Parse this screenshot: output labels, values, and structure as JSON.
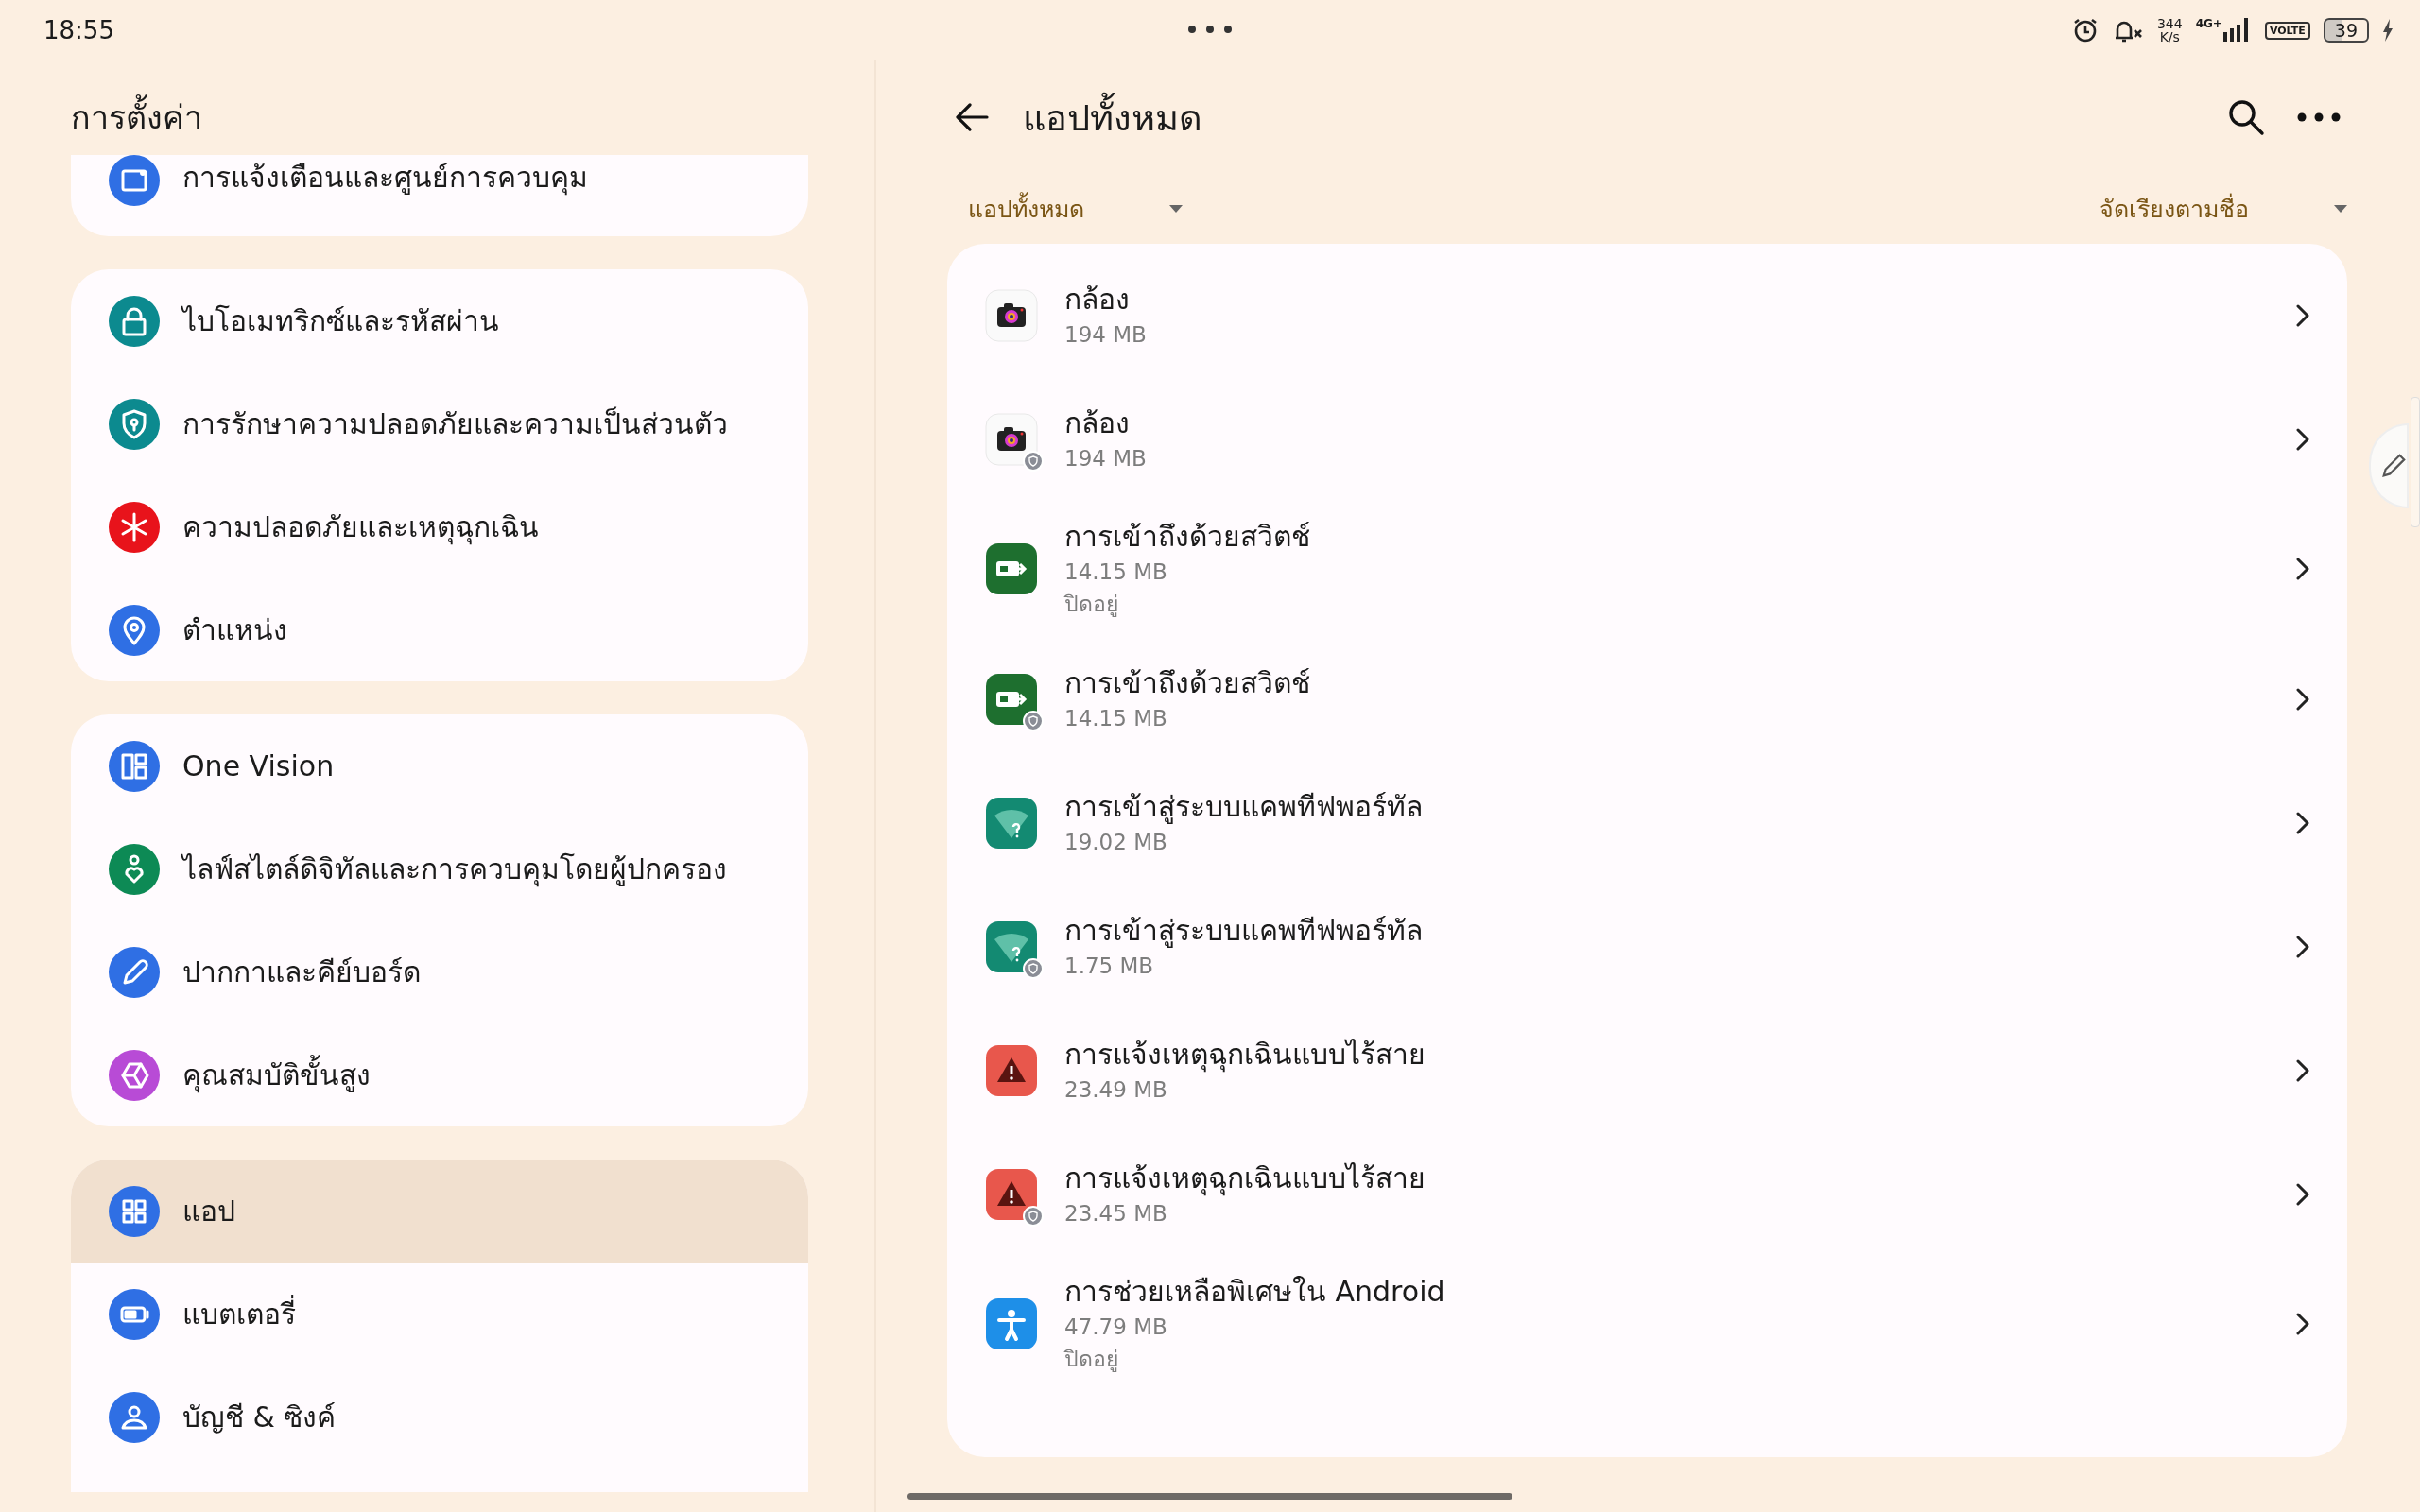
{
  "status_bar": {
    "time": "18:55",
    "speed_value": "344",
    "speed_unit": "K/s",
    "network": "4G+",
    "volte": "VOLTE",
    "battery": "39"
  },
  "settings": {
    "title": "การตั้งค่า",
    "groups": [
      {
        "items": [
          {
            "label": "การแจ้งเตือนและศูนย์การควบคุม",
            "kind": "notifications",
            "color": "#2f6fe4",
            "selected": false
          }
        ]
      },
      {
        "items": [
          {
            "label": "ไบโอเมทริกซ์และรหัสผ่าน",
            "kind": "lock",
            "color": "#0c8a8f",
            "selected": false
          },
          {
            "label": "การรักษาความปลอดภัยและความเป็นส่วนตัว",
            "kind": "shield",
            "color": "#0c8a8f",
            "selected": false
          },
          {
            "label": "ความปลอดภัยและเหตุฉุกเฉิน",
            "kind": "emergency",
            "color": "#e8131b",
            "selected": false
          },
          {
            "label": "ตำแหน่ง",
            "kind": "location",
            "color": "#2f6fe4",
            "selected": false
          }
        ]
      },
      {
        "items": [
          {
            "label": "One Vision",
            "kind": "layout",
            "color": "#2f6fe4",
            "selected": false
          },
          {
            "label": "ไลฟ์สไตล์ดิจิทัลและการควบคุมโดยผู้ปกครอง",
            "kind": "wellbeing",
            "color": "#0d8a55",
            "selected": false
          },
          {
            "label": "ปากกาและคีย์บอร์ด",
            "kind": "pen",
            "color": "#2f6fe4",
            "selected": false
          },
          {
            "label": "คุณสมบัติขั้นสูง",
            "kind": "cube",
            "color": "#b84bd6",
            "selected": false
          }
        ]
      },
      {
        "items": [
          {
            "label": "แอป",
            "kind": "apps",
            "color": "#2f6fe4",
            "selected": true
          },
          {
            "label": "แบตเตอรี่",
            "kind": "battery",
            "color": "#2f6fe4",
            "selected": false
          },
          {
            "label": "บัญชี & ซิงค์",
            "kind": "account",
            "color": "#2f6fe4",
            "selected": false
          }
        ]
      }
    ]
  },
  "apps_page": {
    "title": "แอปทั้งหมด",
    "filter": "แอปทั้งหมด",
    "sort": "จัดเรียงตามชื่อ",
    "apps": [
      {
        "name": "กล้อง",
        "size": "194 MB",
        "kind": "camera",
        "work": false
      },
      {
        "name": "กล้อง",
        "size": "194 MB",
        "kind": "camera",
        "work": true
      },
      {
        "name": "การเข้าถึงด้วยสวิตช์",
        "size": "14.15 MB",
        "status": "ปิดอยู่",
        "kind": "switch",
        "work": false
      },
      {
        "name": "การเข้าถึงด้วยสวิตช์",
        "size": "14.15 MB",
        "kind": "switch",
        "work": true
      },
      {
        "name": "การเข้าสู่ระบบแคพทีฟพอร์ทัล",
        "size": "19.02 MB",
        "kind": "portal",
        "work": false
      },
      {
        "name": "การเข้าสู่ระบบแคพทีฟพอร์ทัล",
        "size": "1.75 MB",
        "kind": "portal",
        "work": true
      },
      {
        "name": "การแจ้งเหตุฉุกเฉินแบบไร้สาย",
        "size": "23.49 MB",
        "kind": "alert",
        "work": false
      },
      {
        "name": "การแจ้งเหตุฉุกเฉินแบบไร้สาย",
        "size": "23.45 MB",
        "kind": "alert",
        "work": true
      },
      {
        "name": "การช่วยเหลือพิเศษใน Android",
        "size": "47.79 MB",
        "status": "ปิดอยู่",
        "kind": "accessibility",
        "work": false
      }
    ]
  }
}
